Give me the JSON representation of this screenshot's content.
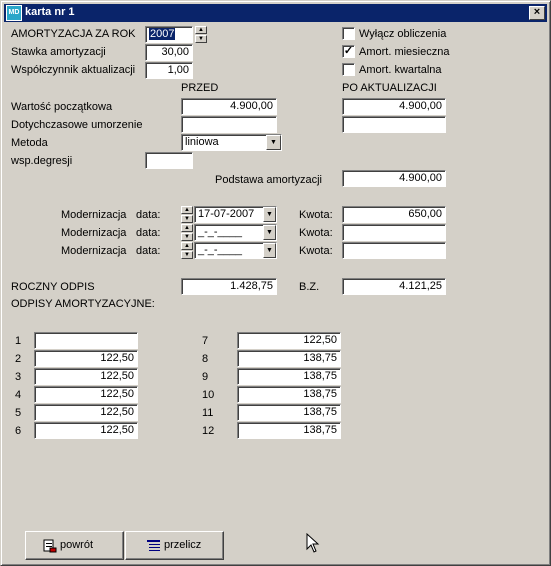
{
  "window": {
    "title": "karta nr 1",
    "icon_text": "MD",
    "close_label": "×"
  },
  "header": {
    "rok_label": "AMORTYZACJA ZA ROK",
    "rok_value": "2007",
    "stawka_label": "Stawka amortyzacji",
    "stawka_value": "30,00",
    "wsp_label": "Współczynnik aktualizacji",
    "wsp_value": "1,00"
  },
  "options": {
    "wylacz_label": "Wyłącz obliczenia",
    "wylacz_checked": "",
    "miesieczna_label": "Amort. miesieczna",
    "miesieczna_checked": "✓",
    "kwartalna_label": "Amort. kwartalna",
    "kwartalna_checked": ""
  },
  "columns": {
    "przed": "PRZED",
    "po": "PO AKTUALIZACJI"
  },
  "valuation": {
    "wartosc_label": "Wartość początkowa",
    "wartosc_przed": "4.900,00",
    "wartosc_po": "4.900,00",
    "umorzenie_label": "Dotychczasowe umorzenie",
    "umorzenie_przed": "",
    "umorzenie_po": "",
    "metoda_label": "Metoda",
    "metoda_value": "liniowa",
    "degresji_label": "wsp.degresji",
    "degresji_value": "",
    "podstawa_label": "Podstawa amortyzacji",
    "podstawa_value": "4.900,00"
  },
  "modernizacje": [
    {
      "label": "Modernizacja",
      "date_label": "data:",
      "date": "17-07-2007",
      "kwota_label": "Kwota:",
      "kwota": "650,00"
    },
    {
      "label": "Modernizacja",
      "date_label": "data:",
      "date": "_-_-____",
      "kwota_label": "Kwota:",
      "kwota": ""
    },
    {
      "label": "Modernizacja",
      "date_label": "data:",
      "date": "_-_-____",
      "kwota_label": "Kwota:",
      "kwota": ""
    }
  ],
  "summary": {
    "odpis_label": "ROCZNY ODPIS",
    "odpis_value": "1.428,75",
    "bz_label": "B.Z.",
    "bz_value": "4.121,25",
    "odpisy_label": "ODPISY AMORTYZACYJNE:"
  },
  "months": [
    {
      "num": "1",
      "value": ""
    },
    {
      "num": "2",
      "value": "122,50"
    },
    {
      "num": "3",
      "value": "122,50"
    },
    {
      "num": "4",
      "value": "122,50"
    },
    {
      "num": "5",
      "value": "122,50"
    },
    {
      "num": "6",
      "value": "122,50"
    },
    {
      "num": "7",
      "value": "122,50"
    },
    {
      "num": "8",
      "value": "138,75"
    },
    {
      "num": "9",
      "value": "138,75"
    },
    {
      "num": "10",
      "value": "138,75"
    },
    {
      "num": "11",
      "value": "138,75"
    },
    {
      "num": "12",
      "value": "138,75"
    }
  ],
  "buttons": {
    "powrot": "powrót",
    "przelicz": "przelicz"
  },
  "icons": {
    "powrot_icon": "printer-back-icon",
    "przelicz_icon": "list-calc-icon"
  }
}
